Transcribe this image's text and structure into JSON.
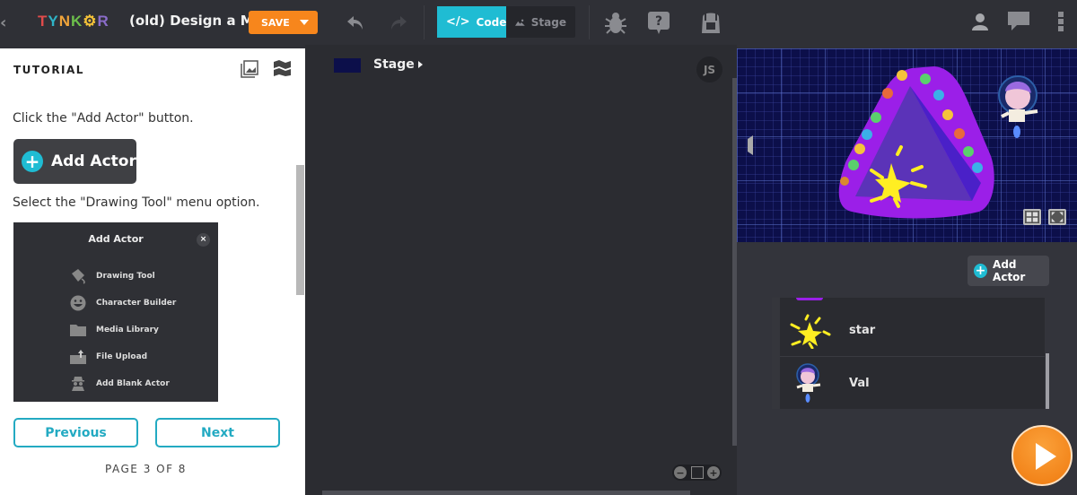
{
  "topbar": {
    "back_glyph": "‹",
    "logo_letters": [
      {
        "ch": "T",
        "color": "#e04b4b"
      },
      {
        "ch": "Y",
        "color": "#2fb3c6"
      },
      {
        "ch": "N",
        "color": "#f0a43a"
      },
      {
        "ch": "K",
        "color": "#6cbf4b"
      },
      {
        "ch": "⚙",
        "color": "#f6c338"
      },
      {
        "ch": "R",
        "color": "#8a6cc9"
      }
    ],
    "project_title": "(old) Design a M",
    "save_label": "SAVE",
    "tabs": [
      {
        "label": "Code",
        "icon": "code-icon",
        "active": true
      },
      {
        "label": "Stage",
        "icon": "image-icon",
        "active": false
      }
    ],
    "icons": [
      "undo-icon",
      "redo-icon",
      "bug-icon",
      "help-icon",
      "backpack-icon",
      "user-icon",
      "chat-icon",
      "more-icon"
    ]
  },
  "tutorial": {
    "header": "TUTORIAL",
    "step1_text": "Click the \"Add Actor\" button.",
    "add_actor_label": "Add Actor",
    "step2_text": "Select the \"Drawing Tool\" menu option.",
    "menu": {
      "title": "Add Actor",
      "close": "×",
      "items": [
        {
          "label": "Drawing Tool",
          "icon": "paint-bucket-icon"
        },
        {
          "label": "Character Builder",
          "icon": "smiley-icon"
        },
        {
          "label": "Media Library",
          "icon": "folder-icon"
        },
        {
          "label": "File Upload",
          "icon": "upload-icon"
        },
        {
          "label": "Add Blank Actor",
          "icon": "spy-icon"
        }
      ]
    },
    "previous_label": "Previous",
    "next_label": "Next",
    "page_indicator": "PAGE 3 OF 8",
    "current_page": 3,
    "total_pages": 8
  },
  "code": {
    "stage_label": "Stage",
    "js_badge": "JS",
    "zoom_out": "−",
    "zoom_in": "+"
  },
  "actors": {
    "add_actor_label": "Add Actor",
    "list": [
      {
        "name": "star"
      },
      {
        "name": "Val"
      }
    ]
  },
  "colors": {
    "accent": "#1fbcd3",
    "save": "#f7861c",
    "run": "#f08a1a",
    "stage_bg": "#0c0f4a"
  }
}
